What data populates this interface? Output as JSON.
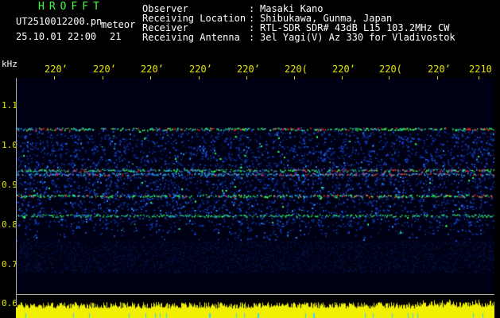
{
  "header": {
    "title": "HROFFT",
    "filename": "UT2510012200.pn",
    "mode": "meteor",
    "datetime": "25.10.01 22:00",
    "count": "21"
  },
  "meta": [
    {
      "label": "Observer",
      "value": "Masaki Kano"
    },
    {
      "label": "Receiving Location",
      "value": "Shibukawa, Gunma, Japan"
    },
    {
      "label": "Receiver",
      "value": "RTL-SDR SDR# 43dB L15 103.2MHz CW"
    },
    {
      "label": "Receiving Antenna",
      "value": "3el Yagi(V) Az 330 for Vladivostok"
    }
  ],
  "meta_separator": ":",
  "axis": {
    "y_unit": "kHz",
    "y_ticks": [
      "1.1",
      "1.0",
      "0.9",
      "0.8",
      "0.7",
      "0.6"
    ],
    "x_ticks": [
      "220",
      "220",
      "220",
      "220",
      "220",
      "220",
      "220",
      "220",
      "220",
      "2210"
    ],
    "x_tick_suffix_glyphs": [
      "’",
      "’",
      "ʼ",
      "ʼ",
      "ʼ",
      "(",
      "’",
      "(",
      "ʼ",
      ""
    ]
  },
  "colors": {
    "background": "#000000",
    "title": "#3cff3c",
    "axis_text": "#e6e600",
    "signal_high": "#ff3030",
    "signal_mid": "#30ff60",
    "noise": "#1040c0"
  },
  "bands_khz": [
    1.03,
    0.93,
    0.91,
    0.86,
    0.82
  ],
  "band_range_khz": [
    0.76,
    1.04
  ]
}
